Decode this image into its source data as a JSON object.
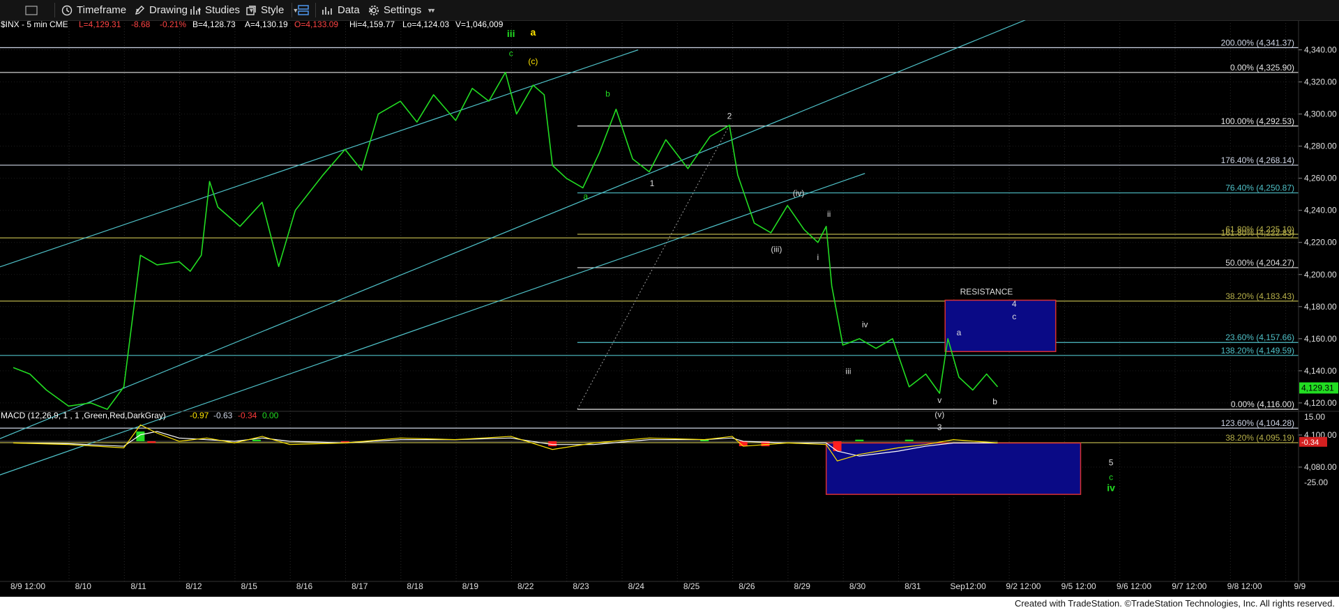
{
  "toolbar": {
    "items": [
      {
        "label": "Timeframe",
        "icon": "clock-icon"
      },
      {
        "label": "Drawing",
        "icon": "pencil-icon"
      },
      {
        "label": "Studies",
        "icon": "studies-icon"
      },
      {
        "label": "Style",
        "icon": "style-icon"
      },
      {
        "label": "",
        "icon": "layout-icon"
      },
      {
        "label": "Data",
        "icon": "bar-data-icon"
      },
      {
        "label": "Settings",
        "icon": "gear-icon"
      }
    ]
  },
  "footer": {
    "text": "Created with TradeStation. ©TradeStation Technologies, Inc. All rights reserved."
  },
  "chart_data": {
    "type": "line",
    "header": {
      "symbol": "$INX - 5 min  CME",
      "last": "L=4,129.31",
      "change": "-8.68",
      "change_pct": "-0.21%",
      "bid": "B=4,128.73",
      "ask": "A=4,130.19",
      "open": "O=4,133.09",
      "high": "Hi=4,159.77",
      "low": "Lo=4,124.03",
      "volume": "V=1,046,009"
    },
    "ylim": [
      4060,
      4360
    ],
    "y_ticks": [
      "4,340.00",
      "4,320.00",
      "4,300.00",
      "4,280.00",
      "4,260.00",
      "4,240.00",
      "4,220.00",
      "4,200.00",
      "4,180.00",
      "4,160.00",
      "4,140.00",
      "4,120.00",
      "4,100.00",
      "4,080.00"
    ],
    "y_tick_values": [
      4340,
      4320,
      4300,
      4280,
      4260,
      4240,
      4220,
      4200,
      4180,
      4160,
      4140,
      4120,
      4100,
      4080
    ],
    "last_price_label": "4,129.31",
    "x_labels": [
      "8/9 12:00",
      "8/10",
      "8/11",
      "8/12",
      "8/15",
      "8/16",
      "8/17",
      "8/18",
      "8/19",
      "8/22",
      "8/23",
      "8/24",
      "8/25",
      "8/26",
      "8/29",
      "8/30",
      "8/31",
      "Sep12:00",
      "9/2 12:00",
      "9/5 12:00",
      "9/6 12:00",
      "9/7 12:00",
      "9/8 12:00",
      "9/9"
    ],
    "series": [
      {
        "name": "$INX",
        "color": "#22dd22",
        "points": [
          [
            0,
            4142
          ],
          [
            0.3,
            4138
          ],
          [
            0.6,
            4128
          ],
          [
            1,
            4118
          ],
          [
            1.4,
            4120
          ],
          [
            1.7,
            4116
          ],
          [
            2,
            4130
          ],
          [
            2.3,
            4212
          ],
          [
            2.6,
            4206
          ],
          [
            3,
            4208
          ],
          [
            3.2,
            4202
          ],
          [
            3.4,
            4212
          ],
          [
            3.55,
            4258
          ],
          [
            3.7,
            4242
          ],
          [
            4.1,
            4230
          ],
          [
            4.5,
            4245
          ],
          [
            4.8,
            4205
          ],
          [
            5.1,
            4240
          ],
          [
            5.6,
            4262
          ],
          [
            6,
            4278
          ],
          [
            6.3,
            4265
          ],
          [
            6.6,
            4300
          ],
          [
            7,
            4308
          ],
          [
            7.3,
            4295
          ],
          [
            7.6,
            4312
          ],
          [
            8,
            4296
          ],
          [
            8.3,
            4316
          ],
          [
            8.6,
            4308
          ],
          [
            8.9,
            4326
          ],
          [
            9.1,
            4300
          ],
          [
            9.4,
            4318
          ],
          [
            9.6,
            4312
          ],
          [
            9.75,
            4268
          ],
          [
            10,
            4260
          ],
          [
            10.3,
            4254
          ],
          [
            10.6,
            4276
          ],
          [
            10.9,
            4303
          ],
          [
            11.2,
            4272
          ],
          [
            11.5,
            4264
          ],
          [
            11.8,
            4284
          ],
          [
            12.2,
            4266
          ],
          [
            12.6,
            4286
          ],
          [
            12.95,
            4293
          ],
          [
            13.1,
            4262
          ],
          [
            13.4,
            4232
          ],
          [
            13.7,
            4226
          ],
          [
            14,
            4243
          ],
          [
            14.3,
            4228
          ],
          [
            14.55,
            4220
          ],
          [
            14.7,
            4230
          ],
          [
            14.8,
            4193
          ],
          [
            15,
            4156
          ],
          [
            15.3,
            4160
          ],
          [
            15.6,
            4154
          ],
          [
            15.9,
            4160
          ],
          [
            16.2,
            4130
          ],
          [
            16.5,
            4138
          ],
          [
            16.75,
            4126
          ],
          [
            16.9,
            4160
          ],
          [
            17.1,
            4136
          ],
          [
            17.35,
            4128
          ],
          [
            17.6,
            4138
          ],
          [
            17.8,
            4130
          ]
        ]
      }
    ],
    "channel_lines": [
      {
        "color": "#4fc1c8",
        "from": [
          -1.5,
          4190
        ],
        "to": [
          11.3,
          4340
        ]
      },
      {
        "color": "#4fc1c8",
        "from": [
          -1.5,
          4080
        ],
        "to": [
          18.4,
          4360
        ]
      },
      {
        "color": "#4fc1c8",
        "from": [
          -1.5,
          4060
        ],
        "to": [
          15.4,
          4263
        ]
      }
    ],
    "dotted_line": {
      "color": "#a0a0a0",
      "from": [
        10.2,
        4116
      ],
      "to": [
        12.95,
        4293
      ]
    },
    "fib_levels": [
      {
        "label": "200.00% (4,341.37)",
        "value": 4341.37,
        "color": "#cfd6e6",
        "x_start": -1.5
      },
      {
        "label": "0.00% (4,325.90)",
        "value": 4325.9,
        "color": "#e8e8e8",
        "x_start": -1.5
      },
      {
        "label": "100.00% (4,292.53)",
        "value": 4292.53,
        "color": "#e8e8e8",
        "x_start": 10.2
      },
      {
        "label": "176.40% (4,268.14)",
        "value": 4268.14,
        "color": "#cfd6e6",
        "x_start": -1.5
      },
      {
        "label": "76.40% (4,250.87)",
        "value": 4250.87,
        "color": "#4fc1c8",
        "x_start": 10.2
      },
      {
        "label": "61.80% (4,225.10)",
        "value": 4225.1,
        "color": "#b8b14a",
        "x_start": 10.2
      },
      {
        "label": "161.80% (4,222.83)",
        "value": 4222.83,
        "color": "#b8b14a",
        "x_start": -1.5
      },
      {
        "label": "50.00% (4,204.27)",
        "value": 4204.27,
        "color": "#dddddd",
        "x_start": 10.2
      },
      {
        "label": "38.20% (4,183.43)",
        "value": 4183.43,
        "color": "#b8b14a",
        "x_start": -1.5
      },
      {
        "label": "23.60% (4,157.66)",
        "value": 4157.66,
        "color": "#4fc1c8",
        "x_start": 10.2
      },
      {
        "label": "138.20% (4,149.59)",
        "value": 4149.59,
        "color": "#4fc1c8",
        "x_start": -1.5
      },
      {
        "label": "0.00% (4,116.00)",
        "value": 4116.0,
        "color": "#e8e8e8",
        "x_start": 10.2
      },
      {
        "label": "123.60% (4,104.28)",
        "value": 4104.28,
        "color": "#cfd6e6",
        "x_start": -1.5
      },
      {
        "label": "38.20% (4,095.19)",
        "value": 4095.19,
        "color": "#b8b14a",
        "x_start": -1.5
      }
    ],
    "boxes": [
      {
        "name": "resistance-box",
        "x0": 16.85,
        "x1": 18.85,
        "y0": 4152,
        "y1": 4184,
        "fill": "#0a0a86",
        "border": "#d83030",
        "label": "RESISTANCE"
      },
      {
        "name": "target-box",
        "x0": 14.7,
        "x1": 19.3,
        "y0": 4063,
        "y1": 4095,
        "fill": "#0a0a86",
        "border": "#d83030",
        "label": ""
      }
    ],
    "wave_labels": [
      {
        "text": "iii",
        "x": 9,
        "y": 4348,
        "color": "#22dd22",
        "bold": true
      },
      {
        "text": "a",
        "x": 9.4,
        "y": 4349,
        "color": "#ffe500",
        "bold": true
      },
      {
        "text": "c",
        "x": 9,
        "y": 4336,
        "color": "#22dd22",
        "bold": false
      },
      {
        "text": "(c)",
        "x": 9.4,
        "y": 4331,
        "color": "#ffe500",
        "bold": false
      },
      {
        "text": "b",
        "x": 10.75,
        "y": 4311,
        "color": "#22dd22",
        "bold": false
      },
      {
        "text": "2",
        "x": 12.95,
        "y": 4297,
        "color": "#dddddd",
        "bold": false
      },
      {
        "text": "a",
        "x": 10.35,
        "y": 4247,
        "color": "#22dd22",
        "bold": false
      },
      {
        "text": "1",
        "x": 11.55,
        "y": 4255,
        "color": "#dddddd",
        "bold": false
      },
      {
        "text": "(iv)",
        "x": 14.2,
        "y": 4249,
        "color": "#dddddd",
        "bold": false
      },
      {
        "text": "ii",
        "x": 14.75,
        "y": 4236,
        "color": "#dddddd",
        "bold": false
      },
      {
        "text": "(iii)",
        "x": 13.8,
        "y": 4214,
        "color": "#dddddd",
        "bold": false
      },
      {
        "text": "i",
        "x": 14.55,
        "y": 4209,
        "color": "#dddddd",
        "bold": false
      },
      {
        "text": "iv",
        "x": 15.4,
        "y": 4167,
        "color": "#dddddd",
        "bold": false
      },
      {
        "text": "a",
        "x": 17.1,
        "y": 4162,
        "color": "#dddddd",
        "bold": false
      },
      {
        "text": "4",
        "x": 18.1,
        "y": 4180,
        "color": "#dddddd",
        "bold": false
      },
      {
        "text": "c",
        "x": 18.1,
        "y": 4172,
        "color": "#dddddd",
        "bold": false
      },
      {
        "text": "iii",
        "x": 15.1,
        "y": 4138,
        "color": "#dddddd",
        "bold": false
      },
      {
        "text": "v",
        "x": 16.75,
        "y": 4120,
        "color": "#dddddd",
        "bold": false
      },
      {
        "text": "(v)",
        "x": 16.75,
        "y": 4111,
        "color": "#dddddd",
        "bold": false
      },
      {
        "text": "b",
        "x": 17.75,
        "y": 4119,
        "color": "#dddddd",
        "bold": false
      },
      {
        "text": "3",
        "x": 16.75,
        "y": 4103,
        "color": "#dddddd",
        "bold": false
      },
      {
        "text": "5",
        "x": 19.85,
        "y": 4081,
        "color": "#dddddd",
        "bold": false
      },
      {
        "text": "c",
        "x": 19.85,
        "y": 4072,
        "color": "#22dd22",
        "bold": false
      },
      {
        "text": "iv",
        "x": 19.85,
        "y": 4065,
        "color": "#22dd22",
        "bold": true
      }
    ],
    "macd": {
      "title": "MACD (12,26,9, 1 , 1 ,Green,Red,DarkGray)",
      "values": [
        "-0.97",
        "-0.63",
        "-0.34",
        "0.00"
      ],
      "value_colors": [
        "#ffe500",
        "#cfd6e6",
        "#ff3b3b",
        "#22dd22"
      ],
      "ylim": [
        -30,
        20
      ],
      "y_ticks": [
        "15.00",
        "-0.00",
        "-25.00"
      ],
      "y_tick_values": [
        15,
        0,
        -25
      ],
      "last_label": "-0.34",
      "macd_line": [
        [
          0,
          -1
        ],
        [
          1,
          -2
        ],
        [
          2,
          -4
        ],
        [
          2.3,
          10
        ],
        [
          2.6,
          5
        ],
        [
          3,
          0
        ],
        [
          3.5,
          2
        ],
        [
          4,
          -1
        ],
        [
          4.5,
          3
        ],
        [
          5,
          -2
        ],
        [
          6,
          -1
        ],
        [
          7,
          2
        ],
        [
          8,
          1
        ],
        [
          9,
          3
        ],
        [
          9.75,
          -5
        ],
        [
          10.5,
          -1
        ],
        [
          11.5,
          2
        ],
        [
          12.5,
          1
        ],
        [
          13,
          3
        ],
        [
          13.2,
          -3
        ],
        [
          14,
          -1
        ],
        [
          14.7,
          -2
        ],
        [
          14.9,
          -12
        ],
        [
          15.3,
          -8
        ],
        [
          16,
          -4
        ],
        [
          16.5,
          -2
        ],
        [
          17,
          1
        ],
        [
          17.8,
          -1
        ]
      ],
      "signal_line": [
        [
          0,
          -1
        ],
        [
          1,
          -1.5
        ],
        [
          2,
          -3
        ],
        [
          2.3,
          4
        ],
        [
          2.6,
          6
        ],
        [
          3,
          2
        ],
        [
          3.5,
          1
        ],
        [
          4,
          0
        ],
        [
          4.5,
          2
        ],
        [
          5,
          0
        ],
        [
          6,
          -1
        ],
        [
          7,
          1
        ],
        [
          8,
          1
        ],
        [
          9,
          2
        ],
        [
          9.75,
          -2
        ],
        [
          10.5,
          -2
        ],
        [
          11.5,
          1
        ],
        [
          12.5,
          1
        ],
        [
          13,
          2
        ],
        [
          13.2,
          0
        ],
        [
          14,
          -1
        ],
        [
          14.7,
          -1
        ],
        [
          14.9,
          -6
        ],
        [
          15.3,
          -9
        ],
        [
          16,
          -6
        ],
        [
          16.5,
          -3
        ],
        [
          17,
          -1
        ],
        [
          17.8,
          -1
        ]
      ],
      "histogram": [
        [
          2.3,
          6
        ],
        [
          2.5,
          -1
        ],
        [
          4.4,
          1
        ],
        [
          6,
          -1
        ],
        [
          9.75,
          -3
        ],
        [
          12.5,
          1
        ],
        [
          13.2,
          -3
        ],
        [
          13.6,
          -3
        ],
        [
          14.9,
          -6
        ],
        [
          15.3,
          1
        ],
        [
          16.2,
          1
        ]
      ]
    }
  }
}
